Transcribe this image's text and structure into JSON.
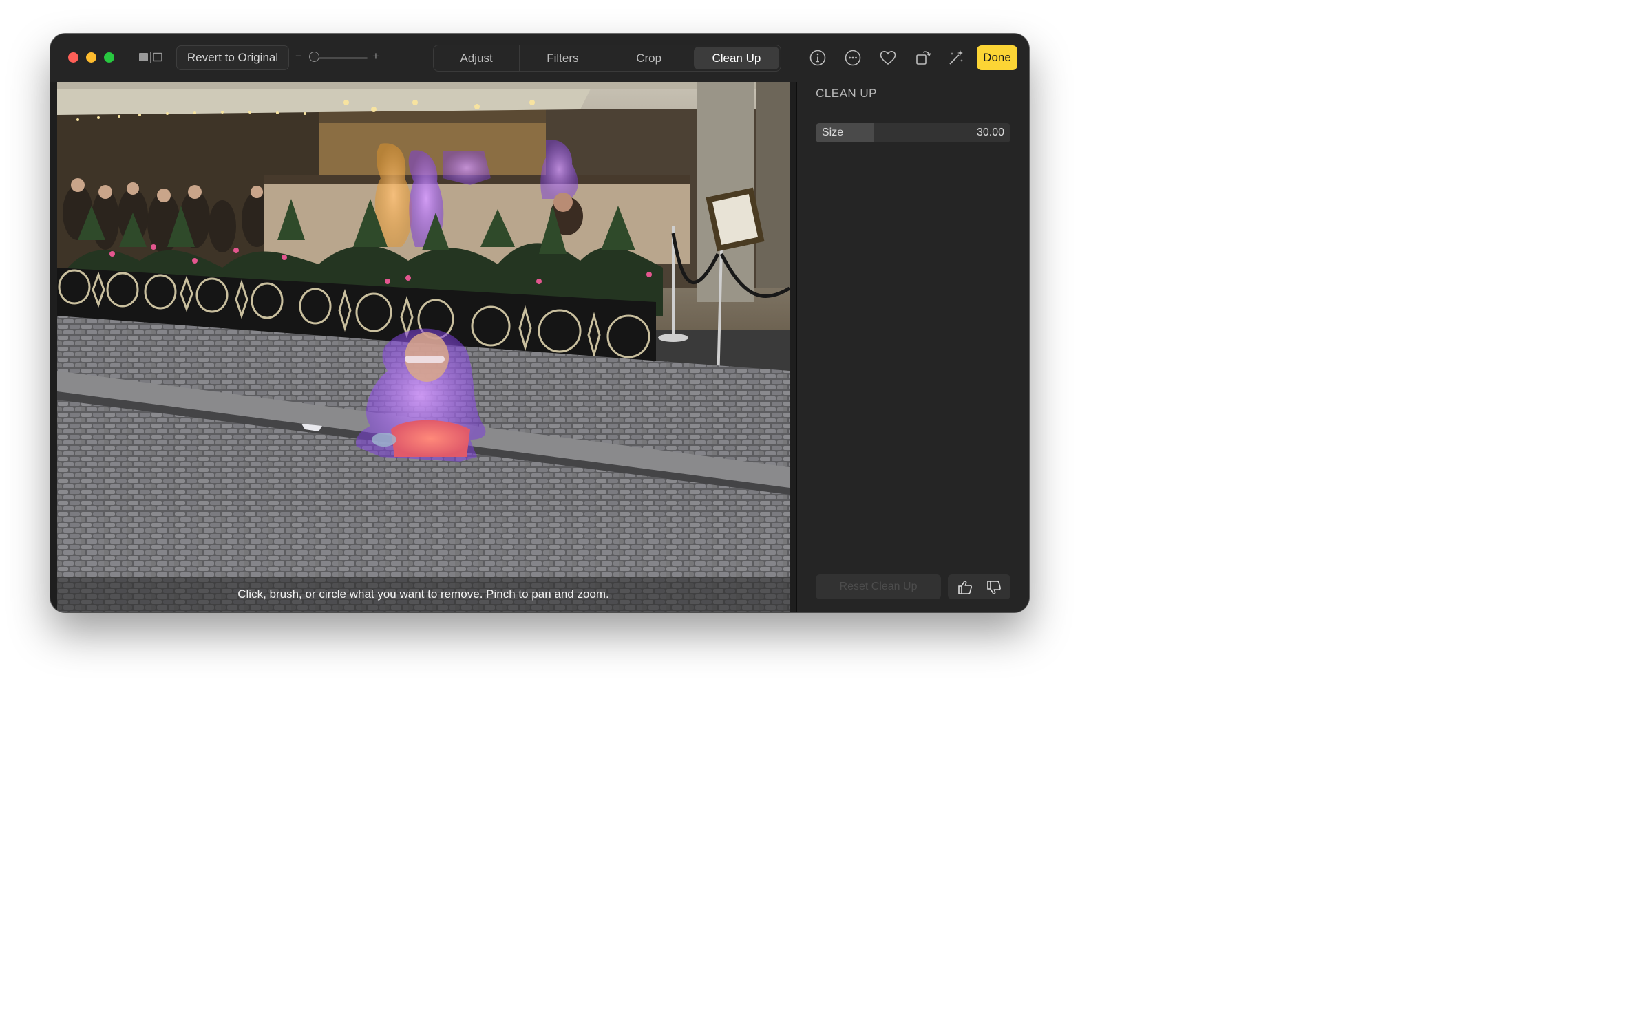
{
  "toolbar": {
    "revert_label": "Revert to Original",
    "zoom_minus": "−",
    "zoom_plus": "+",
    "zoom_level": 0.0,
    "tabs": [
      {
        "label": "Adjust",
        "active": false
      },
      {
        "label": "Filters",
        "active": false
      },
      {
        "label": "Crop",
        "active": false
      },
      {
        "label": "Clean Up",
        "active": true
      }
    ],
    "icons": [
      "info-icon",
      "more-icon",
      "favorite-heart-icon",
      "rotate-icon",
      "auto-enhance-wand-icon"
    ],
    "done_label": "Done"
  },
  "photo": {
    "hint": "Click, brush, or circle what you want to remove. Pinch to pan and zoom."
  },
  "sidebar": {
    "title": "CLEAN UP",
    "size": {
      "label": "Size",
      "value": "30.00",
      "fill": 0.3
    },
    "reset_label": "Reset Clean Up",
    "feedback_icons": [
      "thumbs-up-icon",
      "thumbs-down-icon"
    ]
  },
  "colors": {
    "accent_done": "#fcd535",
    "window_bg": "#1e1e1e",
    "toolbar_bg": "#252525",
    "close": "#fe5f57",
    "minimize": "#febc2e",
    "zoom": "#28c840",
    "selection_glow": "#b06cff"
  }
}
